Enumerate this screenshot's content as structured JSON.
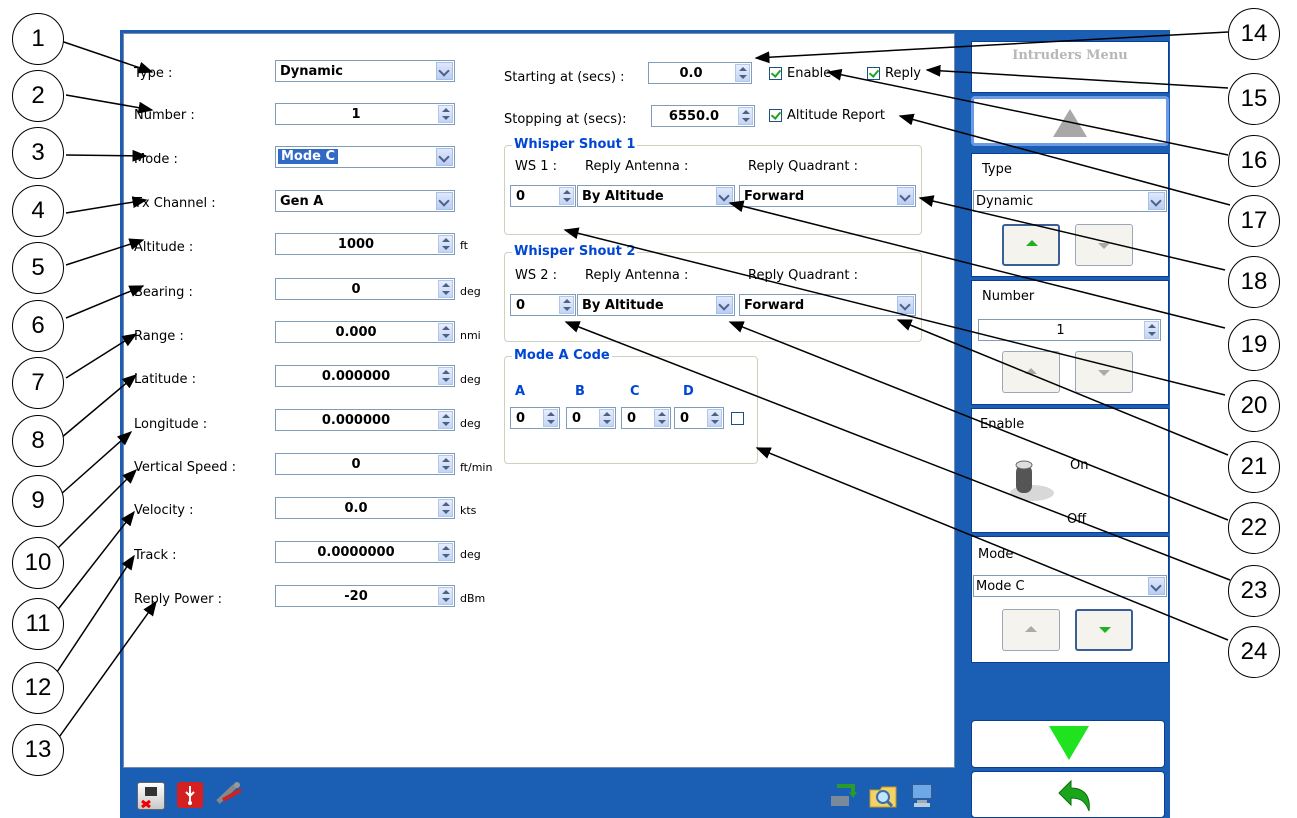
{
  "form": {
    "left_fields": [
      {
        "label": "Type :",
        "value": "Dynamic",
        "control": "combo",
        "unit": ""
      },
      {
        "label": "Number :",
        "value": "1",
        "control": "spin",
        "unit": ""
      },
      {
        "label": "Mode :",
        "value": "Mode C",
        "control": "combo",
        "unit": ""
      },
      {
        "label": "Tx Channel :",
        "value": "Gen A",
        "control": "combo",
        "unit": ""
      },
      {
        "label": "Altitude :",
        "value": "1000",
        "control": "spin",
        "unit": "ft"
      },
      {
        "label": "Bearing :",
        "value": "0",
        "control": "spin",
        "unit": "deg"
      },
      {
        "label": "Range :",
        "value": "0.000",
        "control": "spin",
        "unit": "nmi"
      },
      {
        "label": "Latitude :",
        "value": "0.000000",
        "control": "spin",
        "unit": "deg"
      },
      {
        "label": "Longitude :",
        "value": "0.000000",
        "control": "spin",
        "unit": "deg"
      },
      {
        "label": "Vertical Speed :",
        "value": "0",
        "control": "spin",
        "unit": "ft/min"
      },
      {
        "label": "Velocity :",
        "value": "0.0",
        "control": "spin",
        "unit": "kts"
      },
      {
        "label": "Track :",
        "value": "0.0000000",
        "control": "spin",
        "unit": "deg"
      },
      {
        "label": "Reply Power :",
        "value": "-20",
        "control": "spin",
        "unit": "dBm"
      }
    ],
    "starting": {
      "label": "Starting at (secs) :",
      "value": "0.0"
    },
    "stopping": {
      "label": "Stopping at (secs):",
      "value": "6550.0"
    },
    "enable": {
      "label": "Enable",
      "checked": true
    },
    "reply": {
      "label": "Reply",
      "checked": true
    },
    "altitude_report": {
      "label": "Altitude Report",
      "checked": true
    },
    "ws1": {
      "title": "Whisper Shout 1",
      "ws_label": "WS 1 :",
      "ant_label": "Reply Antenna :",
      "quad_label": "Reply Quadrant :",
      "ws_value": "0",
      "antenna": "By Altitude",
      "quadrant": "Forward"
    },
    "ws2": {
      "title": "Whisper Shout 2",
      "ws_label": "WS 2 :",
      "ant_label": "Reply Antenna :",
      "quad_label": "Reply Quadrant :",
      "ws_value": "0",
      "antenna": "By Altitude",
      "quadrant": "Forward"
    },
    "mode_a": {
      "title": "Mode A Code",
      "letters": [
        "A",
        "B",
        "C",
        "D"
      ],
      "values": [
        "0",
        "0",
        "0",
        "0"
      ],
      "checked": false
    }
  },
  "right_panel": {
    "title": "Intruders Menu",
    "type": {
      "label": "Type",
      "value": "Dynamic"
    },
    "number": {
      "label": "Number",
      "value": "1"
    },
    "enable": {
      "label": "Enable",
      "on": "On",
      "off": "Off"
    },
    "mode": {
      "label": "Mode",
      "value": "Mode C"
    }
  },
  "callouts": [
    "1",
    "2",
    "3",
    "4",
    "5",
    "6",
    "7",
    "8",
    "9",
    "10",
    "11",
    "12",
    "13",
    "14",
    "15",
    "16",
    "17",
    "18",
    "19",
    "20",
    "21",
    "22",
    "23",
    "24"
  ],
  "colors": {
    "window_blue": "#1a5fb4",
    "group_title": "#0046d5",
    "check_green": "#21a121",
    "arrow_green": "#1ee31e"
  },
  "icons": [
    "network-disconnected-icon",
    "usb-icon",
    "tools-icon",
    "transfer-icon",
    "search-folder-icon",
    "display-settings-icon"
  ]
}
